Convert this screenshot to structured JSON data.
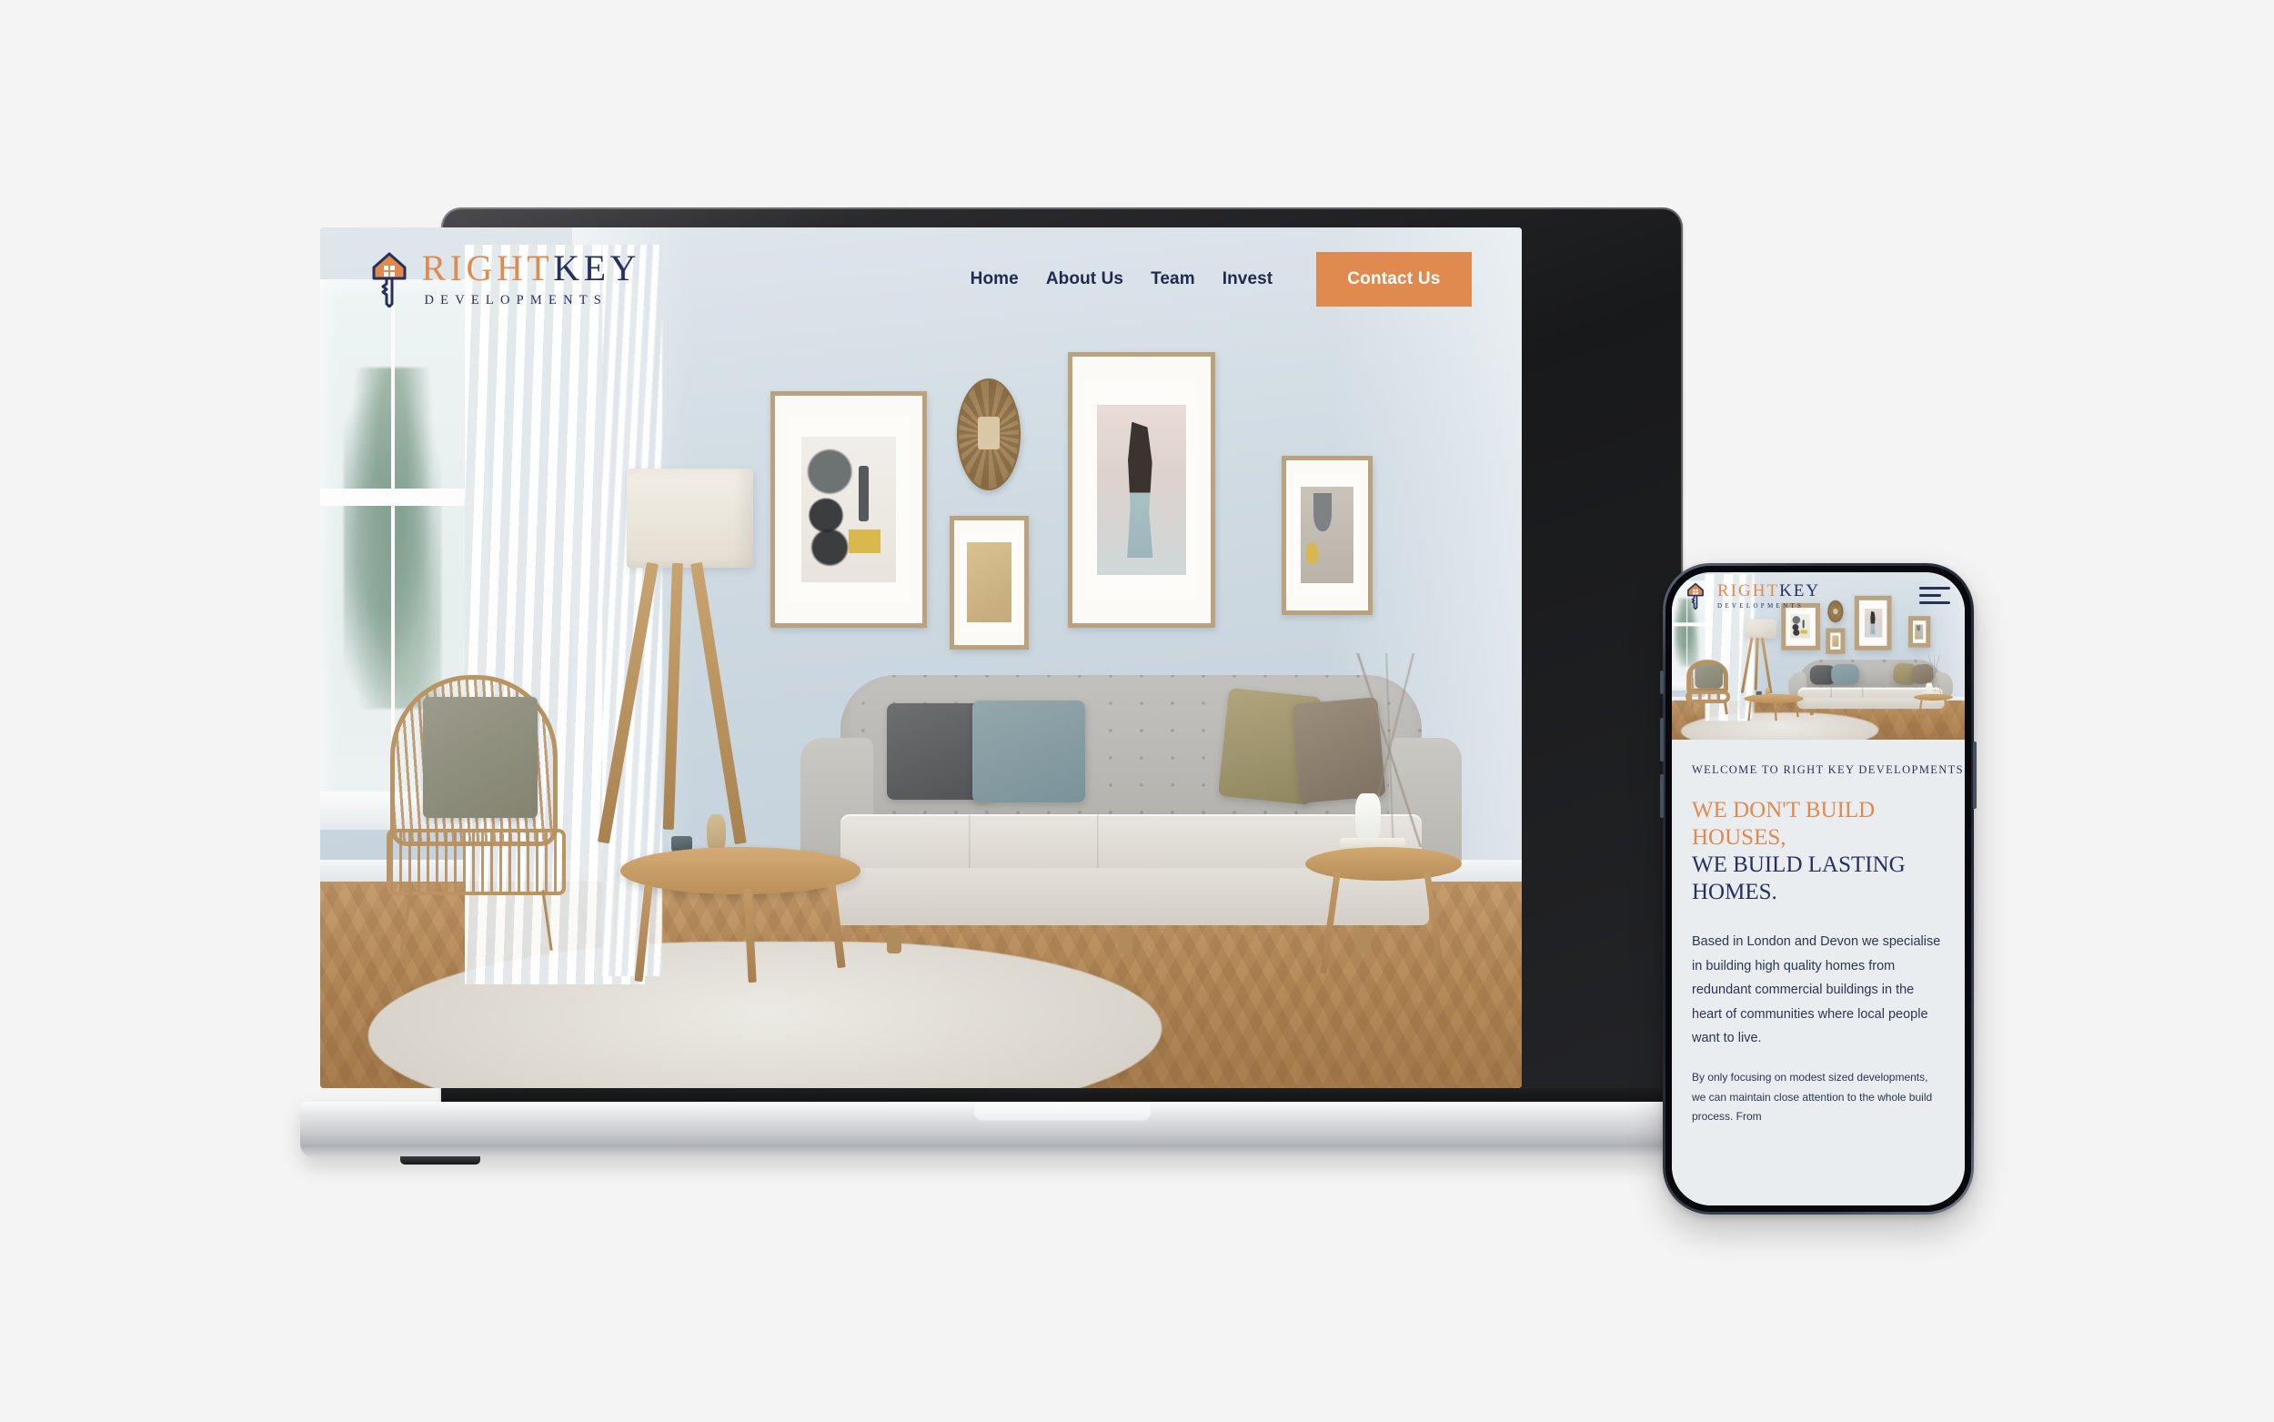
{
  "brand": {
    "name_part1": "RIGHT",
    "name_part2": "KEY",
    "tagline": "DEVELOPMENTS",
    "orange": "#E08A50",
    "navy": "#26305C"
  },
  "desktop": {
    "nav": [
      {
        "label": "Home"
      },
      {
        "label": "About Us"
      },
      {
        "label": "Team"
      },
      {
        "label": "Invest"
      }
    ],
    "contact_button": "Contact Us"
  },
  "mobile": {
    "menu_icon": "hamburger-menu-icon",
    "eyebrow": "WELCOME TO RIGHT KEY DEVELOPMENTS",
    "headline_line1": "WE DON'T BUILD HOUSES,",
    "headline_line2": "WE BUILD LASTING HOMES.",
    "paragraph1": "Based in London and Devon we specialise in building high quality homes from redundant commercial buildings in the heart of communities where local people want to live.",
    "paragraph2": "By only focusing on modest sized developments, we can maintain close attention to the whole build process. From"
  },
  "page_background": "#F4F4F4"
}
